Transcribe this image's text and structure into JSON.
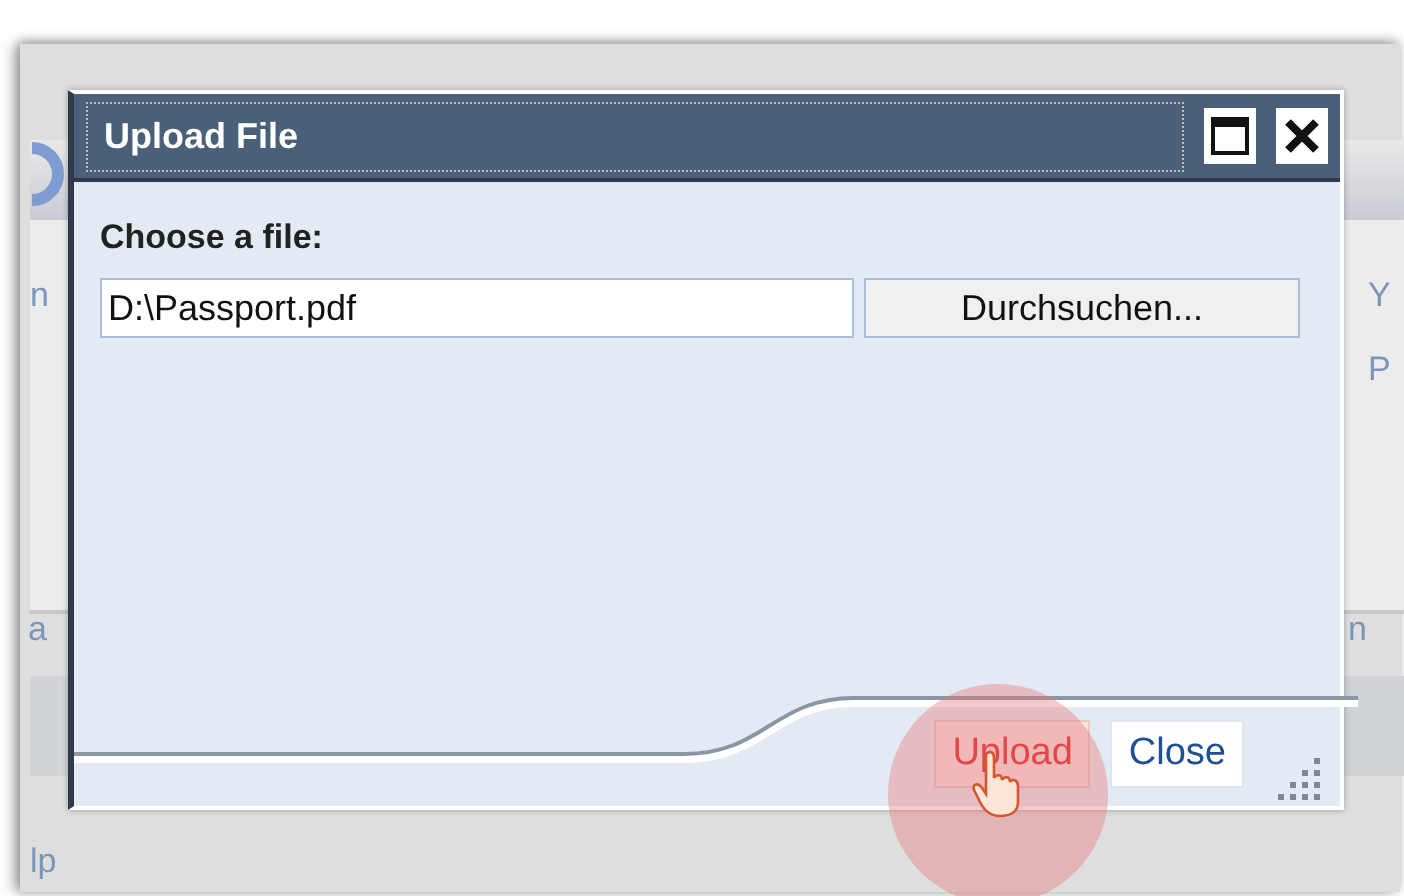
{
  "background_page": {
    "left_texts": [
      "n",
      "a",
      "lp"
    ],
    "right_texts": [
      "Y",
      "P",
      "n"
    ]
  },
  "dialog": {
    "title": "Upload File",
    "label": "Choose a file:",
    "file_field": {
      "value": "D:\\Passport.pdf"
    },
    "browse_button": "Durchsuchen...",
    "buttons": [
      {
        "label": "Upload",
        "hovered": true
      },
      {
        "label": "Close",
        "hovered": false
      }
    ]
  }
}
